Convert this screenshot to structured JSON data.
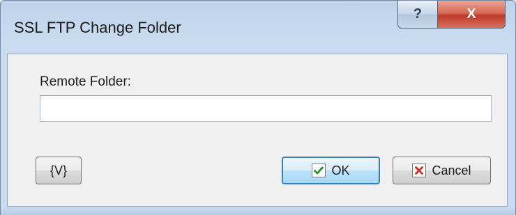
{
  "window": {
    "title": "SSL FTP Change Folder",
    "help_button": "?",
    "close_button": "X"
  },
  "form": {
    "remote_folder_label": "Remote Folder:",
    "remote_folder_value": "",
    "remote_folder_placeholder": ""
  },
  "buttons": {
    "variables_label": "{V}",
    "ok_label": "OK",
    "cancel_label": "Cancel"
  },
  "colors": {
    "ok_check": "#2f8f2f",
    "cancel_x": "#d0302a"
  }
}
